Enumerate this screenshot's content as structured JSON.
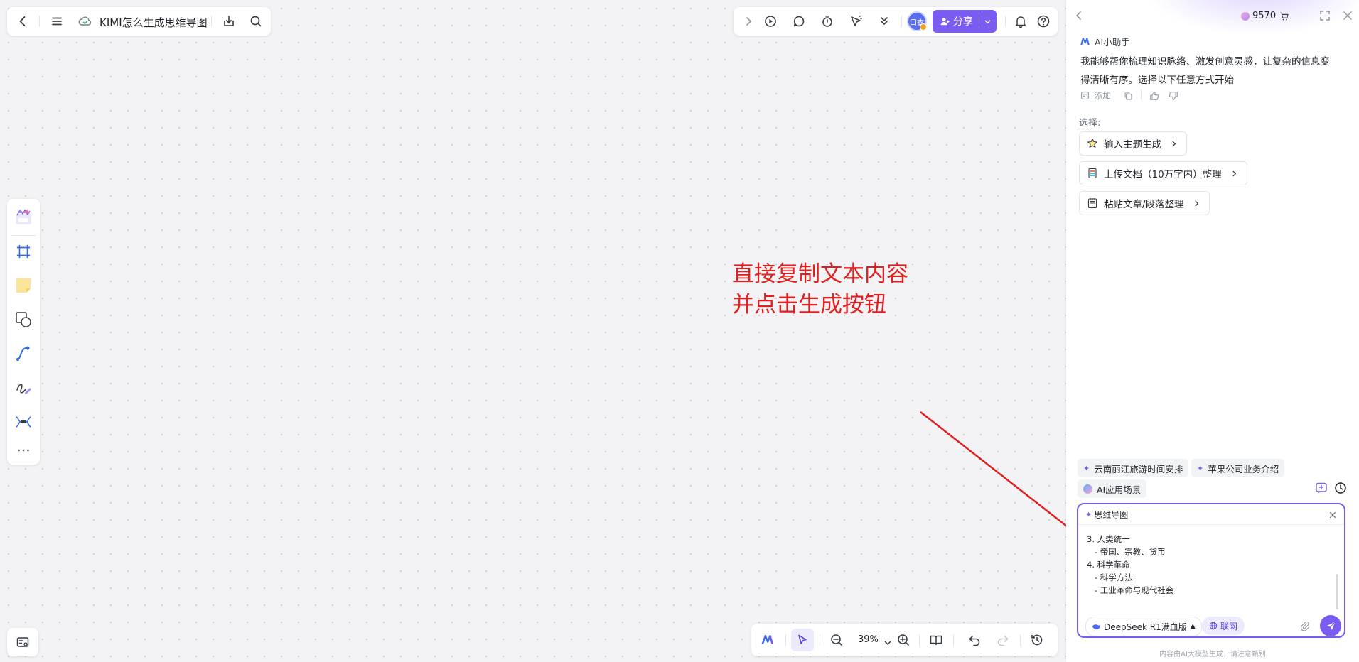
{
  "header": {
    "doc_title": "KIMI怎么生成思维导图"
  },
  "toolbar": {
    "share_label": "分享",
    "avatar_text": "口衣"
  },
  "annotation": {
    "line1": "直接复制文本内容",
    "line2": "并点击生成按钮"
  },
  "bottom_toolbar": {
    "zoom": "39%"
  },
  "panel": {
    "credits": "9570",
    "assistant_name": "AI小助手",
    "intro_line1": "我能够帮你梳理知识脉络、激发创意灵感，让复杂的信息变",
    "intro_line2": "得清晰有序。选择以下任意方式开始",
    "add_label": "添加",
    "select_label": "选择:",
    "choices": [
      {
        "label": "输入主题生成"
      },
      {
        "label": "上传文档（10万字内）整理"
      },
      {
        "label": "粘贴文章/段落整理"
      }
    ],
    "suggestions": [
      "云南丽江旅游时间安排",
      "苹果公司业务介绍"
    ],
    "scene_label": "AI应用场景",
    "mode_tag": "思维导图",
    "input_text": "3. 人类统一\n   - 帝国、宗教、货币\n4. 科学革命\n   - 科学方法\n   - 工业革命与现代社会",
    "model_label": "DeepSeek R1满血版",
    "web_label": "联网",
    "disclaimer": "内容由AI大模型生成，请注意甄别"
  },
  "colors": {
    "accent": "#7b5cf0",
    "annotation": "#e02020",
    "canvas": "#f3f3f5"
  }
}
